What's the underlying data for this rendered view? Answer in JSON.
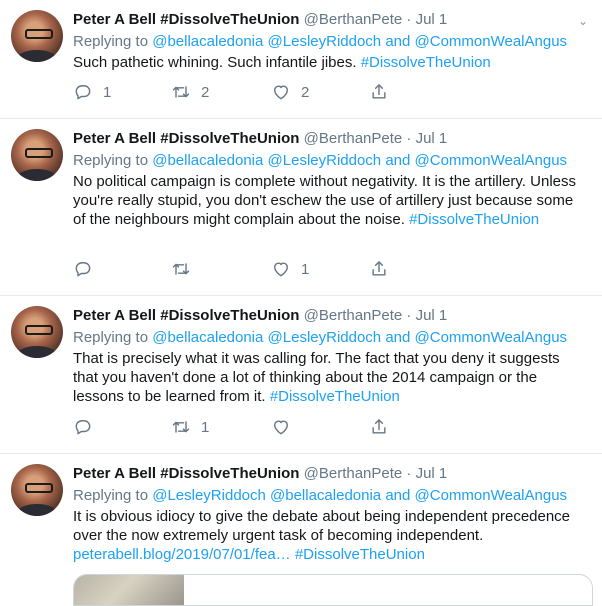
{
  "tweets": [
    {
      "name": "Peter A Bell #DissolveTheUnion",
      "handle": "@BerthanPete",
      "date": "Jul 1",
      "reply_label": "Replying to",
      "reply_to": [
        "@bellacaledonia",
        "@LesleyRiddoch"
      ],
      "reply_and": "and",
      "reply_last": "@CommonWealAngus",
      "text": "Such pathetic whining. Such infantile jibes.",
      "hashtag": "#DissolveTheUnion",
      "link": "",
      "reply_count": "1",
      "retweet_count": "2",
      "like_count": "2"
    },
    {
      "name": "Peter A Bell #DissolveTheUnion",
      "handle": "@BerthanPete",
      "date": "Jul 1",
      "reply_label": "Replying to",
      "reply_to": [
        "@bellacaledonia",
        "@LesleyRiddoch"
      ],
      "reply_and": "and",
      "reply_last": "@CommonWealAngus",
      "text": "No political campaign is complete without negativity. It is the artillery. Unless you're really stupid, you don't eschew the use of artillery just because some of the neighbours might complain about the noise.",
      "hashtag": "#DissolveTheUnion",
      "link": "",
      "reply_count": "",
      "retweet_count": "",
      "like_count": "1"
    },
    {
      "name": "Peter A Bell #DissolveTheUnion",
      "handle": "@BerthanPete",
      "date": "Jul 1",
      "reply_label": "Replying to",
      "reply_to": [
        "@bellacaledonia",
        "@LesleyRiddoch"
      ],
      "reply_and": "and",
      "reply_last": "@CommonWealAngus",
      "text": "That is precisely what it was calling for. The fact that you deny it suggests that you haven't done a lot of thinking about the 2014 campaign or the lessons to be learned from it.",
      "hashtag": "#DissolveTheUnion",
      "link": "",
      "reply_count": "",
      "retweet_count": "1",
      "like_count": ""
    },
    {
      "name": "Peter A Bell #DissolveTheUnion",
      "handle": "@BerthanPete",
      "date": "Jul 1",
      "reply_label": "Replying to",
      "reply_to": [
        "@LesleyRiddoch",
        "@bellacaledonia"
      ],
      "reply_and": "and",
      "reply_last": "@CommonWealAngus",
      "text": "It is obvious idiocy to give the debate about being independent precedence over the now extremely urgent task of becoming independent.",
      "hashtag": "#DissolveTheUnion",
      "link": "peterabell.blog/2019/07/01/fea…",
      "reply_count": "",
      "retweet_count": "",
      "like_count": ""
    }
  ]
}
